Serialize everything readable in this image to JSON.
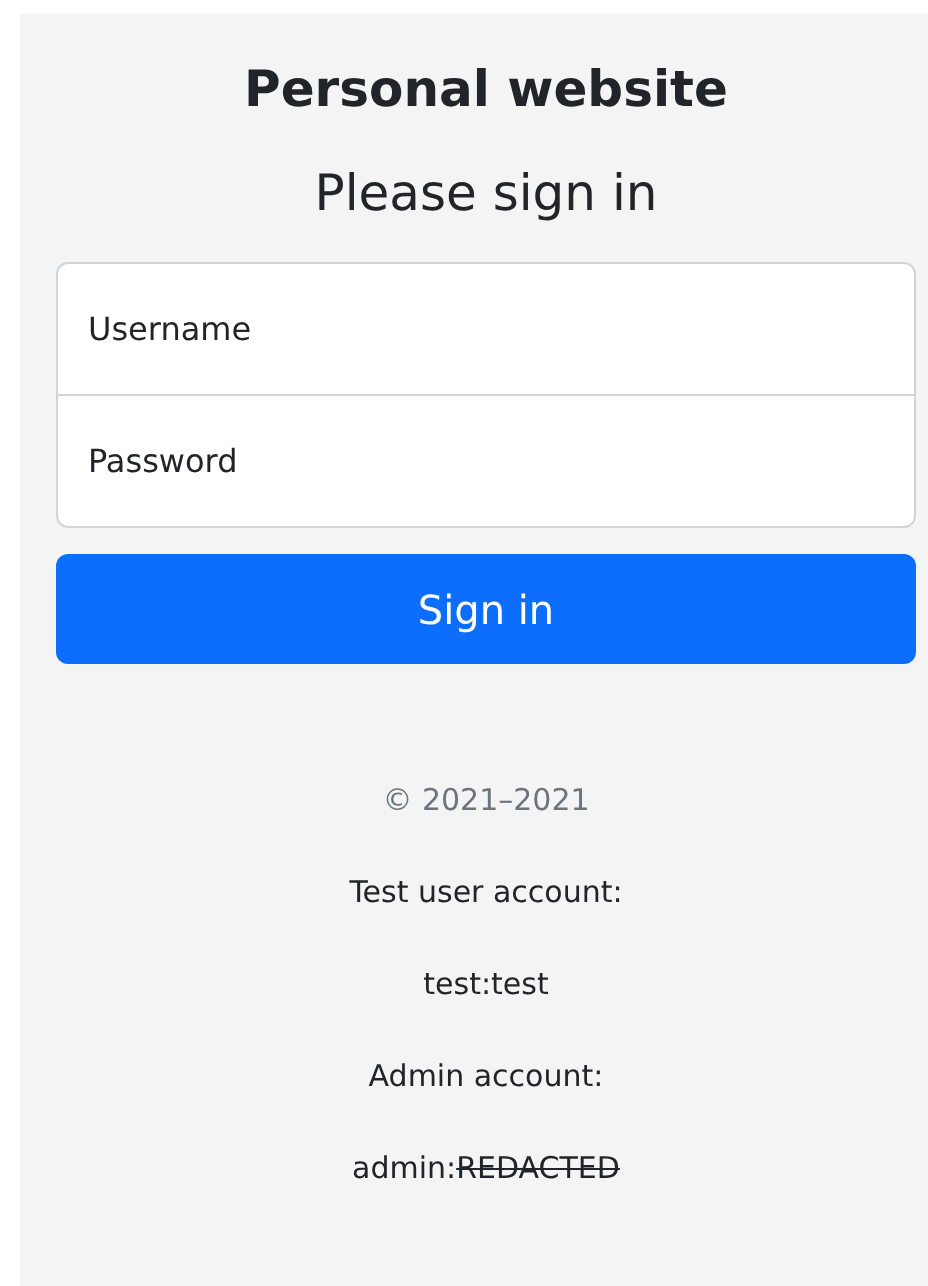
{
  "site_title": "Personal website",
  "heading": "Please sign in",
  "fields": [
    {
      "placeholder": "Username"
    },
    {
      "placeholder": "Password"
    }
  ],
  "submit_button": "Sign in",
  "copyright": "© 2021–2021",
  "notes": [
    {
      "parts": [
        {
          "text": "Test user account:",
          "struck": false
        }
      ]
    },
    {
      "parts": [
        {
          "text": "test:test",
          "struck": false
        }
      ]
    },
    {
      "parts": [
        {
          "text": "Admin account:",
          "struck": false
        }
      ]
    },
    {
      "parts": [
        {
          "text": "admin:",
          "struck": false
        },
        {
          "text": "REDACTED",
          "struck": true
        }
      ]
    }
  ]
}
